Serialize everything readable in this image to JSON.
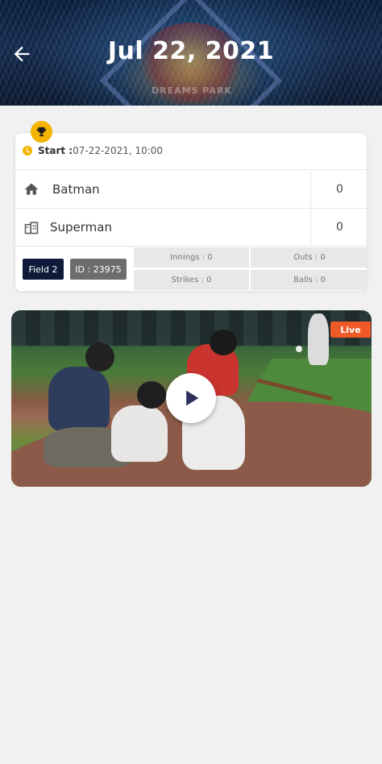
{
  "header": {
    "title": "Jul 22, 2021",
    "logo_text": "DREAMS PARK"
  },
  "match": {
    "start_label": "Start :",
    "start_value": "07-22-2021, 10:00",
    "teams": [
      {
        "name": "Batman",
        "score": "0",
        "icon": "home-icon"
      },
      {
        "name": "Superman",
        "score": "0",
        "icon": "away-team-icon"
      }
    ],
    "field": "Field 2",
    "id": "ID : 23975",
    "stats": {
      "innings": "Innings : 0",
      "outs": "Outs : 0",
      "strikes": "Strikes : 0",
      "balls": "Balls : 0"
    }
  },
  "video": {
    "live_label": "Live",
    "play_icon": "play-icon"
  },
  "colors": {
    "accent": "#f4b400",
    "live": "#f05a28",
    "field_badge": "#0d1a3a",
    "id_badge": "#6d6d6d"
  }
}
